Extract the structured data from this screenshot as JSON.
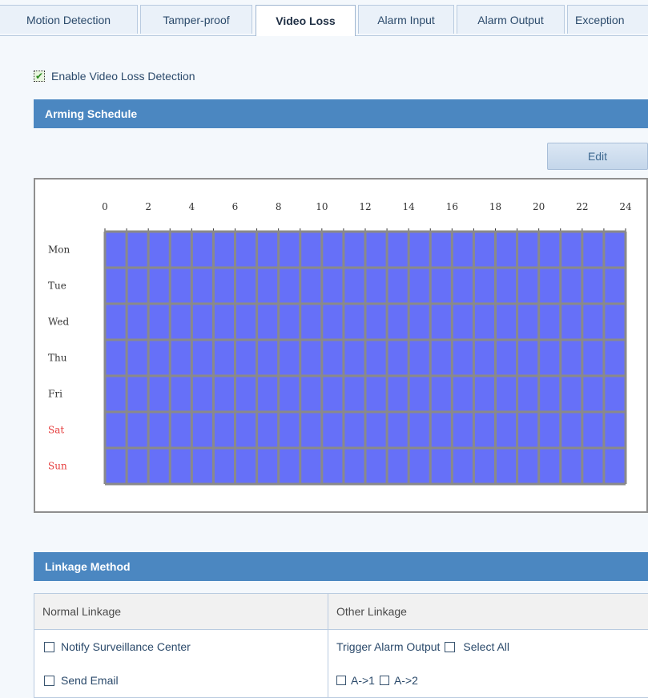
{
  "tabs": [
    {
      "label": "Motion Detection",
      "active": false
    },
    {
      "label": "Tamper-proof",
      "active": false
    },
    {
      "label": "Video Loss",
      "active": true
    },
    {
      "label": "Alarm Input",
      "active": false
    },
    {
      "label": "Alarm Output",
      "active": false
    },
    {
      "label": "Exception",
      "active": false
    }
  ],
  "enable": {
    "label": "Enable Video Loss Detection",
    "checked": true
  },
  "arming_schedule": {
    "title": "Arming Schedule",
    "edit_label": "Edit",
    "hour_labels": [
      "0",
      "2",
      "4",
      "6",
      "8",
      "10",
      "12",
      "14",
      "16",
      "18",
      "20",
      "22",
      "24"
    ],
    "days": [
      {
        "label": "Mon",
        "weekend": false
      },
      {
        "label": "Tue",
        "weekend": false
      },
      {
        "label": "Wed",
        "weekend": false
      },
      {
        "label": "Thu",
        "weekend": false
      },
      {
        "label": "Fri",
        "weekend": false
      },
      {
        "label": "Sat",
        "weekend": true
      },
      {
        "label": "Sun",
        "weekend": true
      }
    ],
    "armed_color": "#6670f8",
    "grid_color": "#8a8a8a",
    "weekday_color": "#333333",
    "weekend_color": "#e53b3b"
  },
  "linkage": {
    "title": "Linkage Method",
    "normal_header": "Normal Linkage",
    "other_header": "Other Linkage",
    "notify_label": "Notify Surveillance Center",
    "email_label": "Send Email",
    "trigger_label": "Trigger Alarm Output",
    "select_all_label": "Select All",
    "outputs": [
      "A->1",
      "A->2"
    ]
  },
  "colors": {
    "header_bg": "#4b87c1",
    "page_bg": "#f4f8fc"
  }
}
